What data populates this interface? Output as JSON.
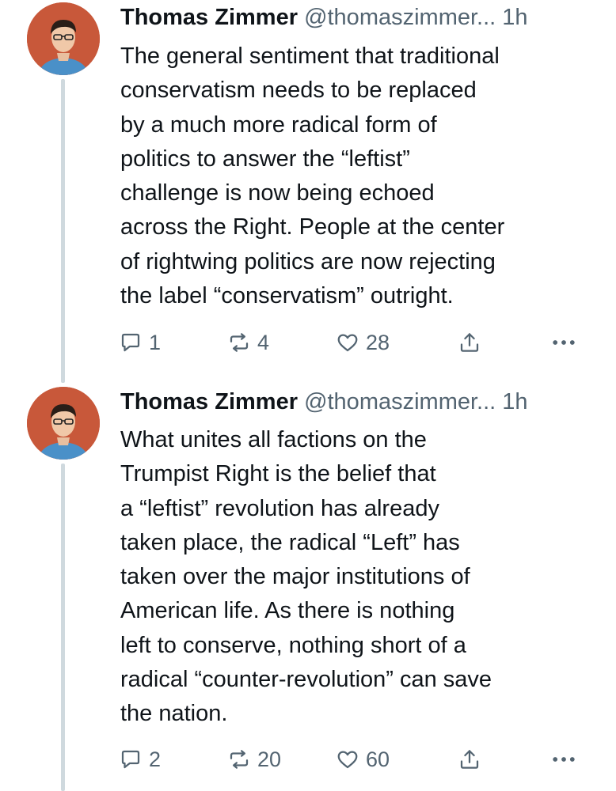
{
  "tweets": [
    {
      "author": "Thomas Zimmer",
      "handle": "@thomaszimmer...",
      "time": "1h",
      "text": "The general sentiment that traditional\nconservatism needs to be replaced\nby a much more radical form of\npolitics to answer the “leftist”\nchallenge is now being echoed\nacross the Right. People at the center\nof rightwing politics are now rejecting\nthe label “conservatism” outright.",
      "replies": "1",
      "retweets": "4",
      "likes": "28"
    },
    {
      "author": "Thomas Zimmer",
      "handle": "@thomaszimmer...",
      "time": "1h",
      "text": "What unites all factions on the\nTrumpist Right is the belief that\na “leftist” revolution has already\ntaken place, the radical “Left” has\ntaken over the major institutions of\nAmerican life. As there is nothing\nleft to conserve, nothing short of a\nradical “counter-revolution” can save\nthe nation.",
      "replies": "2",
      "retweets": "20",
      "likes": "60"
    }
  ],
  "icons": {
    "reply": "reply-icon",
    "retweet": "retweet-icon",
    "like": "heart-icon",
    "share": "share-icon",
    "more": "more-icon"
  },
  "colors": {
    "text": "#0f1419",
    "secondary": "#536471",
    "thread_line": "#cfd9de",
    "avatar_bg": "#c8583a"
  }
}
